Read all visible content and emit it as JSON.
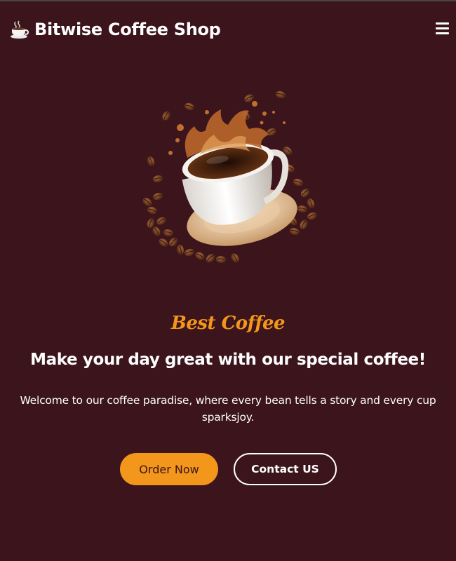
{
  "navbar": {
    "brand_icon": "coffee-cup-icon",
    "brand_title": "Bitwise Coffee Shop",
    "menu_icon": "hamburger-menu-icon"
  },
  "hero": {
    "image": "coffee-cup-splash-with-beans",
    "subtitle": "Best Coffee",
    "title": "Make your day great with our special coffee!",
    "description": "Welcome to our coffee paradise, where every bean tells a story and every cup sparksjoy.",
    "order_button": "Order Now",
    "contact_button": "Contact US"
  },
  "colors": {
    "background": "#3b141c",
    "accent": "#f3961c",
    "text": "#ffffff"
  }
}
